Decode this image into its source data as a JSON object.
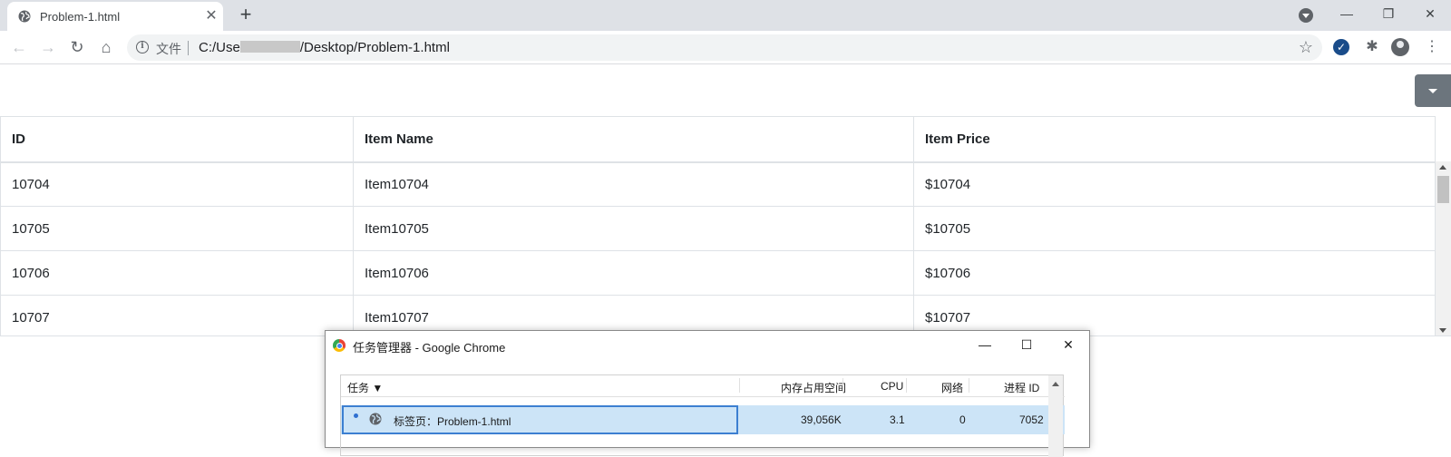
{
  "browser": {
    "tab_title": "Problem-1.html",
    "new_tab_label": "+",
    "close_label": "✕",
    "minimize_label": "—",
    "restore_label": "❐",
    "window_close_label": "✕",
    "security_label": "文件",
    "url_prefix": "C:/Use",
    "url_suffix": "/Desktop/Problem-1.html",
    "colors": {
      "tab_strip": "#dee1e6",
      "omnibox": "#f1f3f4",
      "extension_accent": "#1a4c8a"
    }
  },
  "table": {
    "headers": [
      "ID",
      "Item Name",
      "Item Price"
    ],
    "rows": [
      [
        "10704",
        "Item10704",
        "$10704"
      ],
      [
        "10705",
        "Item10705",
        "$10705"
      ],
      [
        "10706",
        "Item10706",
        "$10706"
      ],
      [
        "10707",
        "Item10707",
        "$10707"
      ]
    ]
  },
  "task_manager": {
    "title": "任务管理器 - Google Chrome",
    "minimize_label": "—",
    "maximize_label": "☐",
    "close_label": "✕",
    "columns": [
      "任务 ▼",
      "内存占用空间",
      "CPU",
      "网络",
      "进程 ID"
    ],
    "row": {
      "task": "标签页：Problem-1.html",
      "memory": "39,056K",
      "cpu": "3.1",
      "network": "0",
      "pid": "7052"
    },
    "colors": {
      "selected_row": "#cce4f7",
      "focus_border": "#3c7fd1"
    }
  }
}
